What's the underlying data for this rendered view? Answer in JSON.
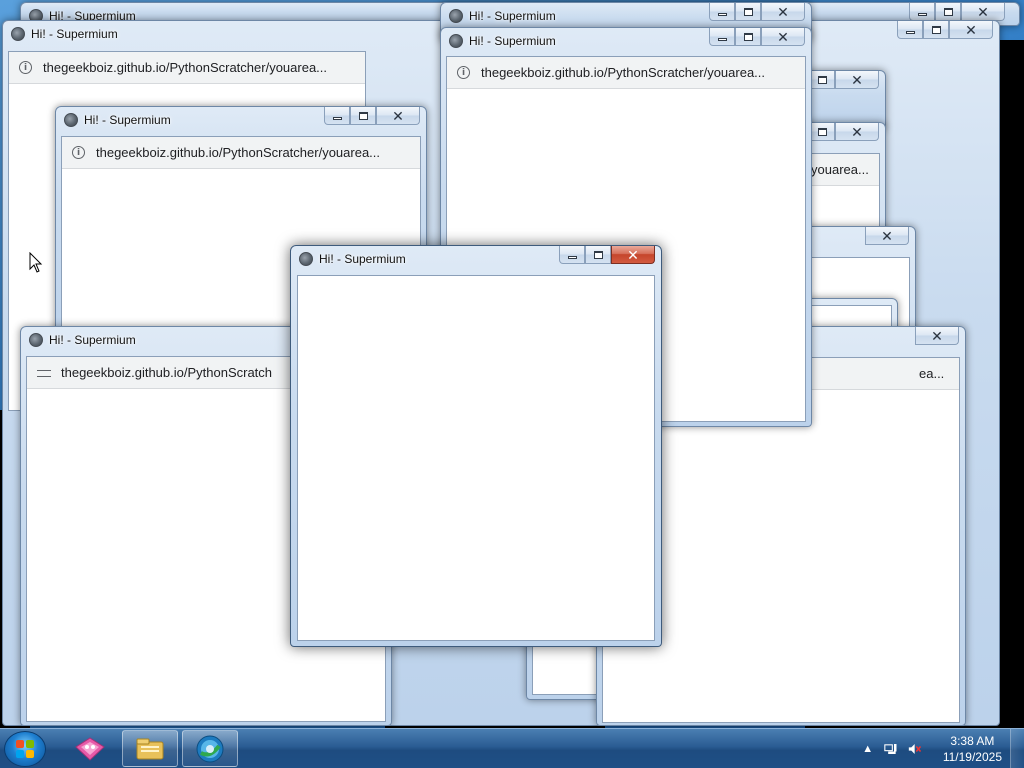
{
  "windows": [
    {
      "title": "Hi! - Supermium",
      "url": "thegeekboiz.github.io/PythonScratcher/youarea..."
    },
    {
      "title": "Hi! - Supermium",
      "url": "thegeekboiz.github.io/PythonScratcher/youarea..."
    },
    {
      "title": "Hi! - Supermium",
      "url": "thegeekboiz.github.io/PythonScratcher/youarea..."
    },
    {
      "title": "Hi! - Supermium",
      "url": "thegeekboiz.github.io/PythonScratcher/youarea..."
    },
    {
      "title": "Hi! - Supermium",
      "url": "thegeekboiz.github.io/PythonScratch"
    },
    {
      "title": "Hi! - Supermium",
      "url": ""
    }
  ],
  "partial_url_fragments": [
    "youarea...",
    "ea..."
  ],
  "taskbar": {
    "items": [
      "start",
      "paint-app",
      "file-explorer",
      "supermium-browser"
    ],
    "clock": {
      "time": "3:38 AM",
      "date": "11/19/2025"
    }
  },
  "colors": {
    "close_active": "#c5452c",
    "titlebar": "#c9dbef",
    "taskbar": "#1f4f86"
  }
}
